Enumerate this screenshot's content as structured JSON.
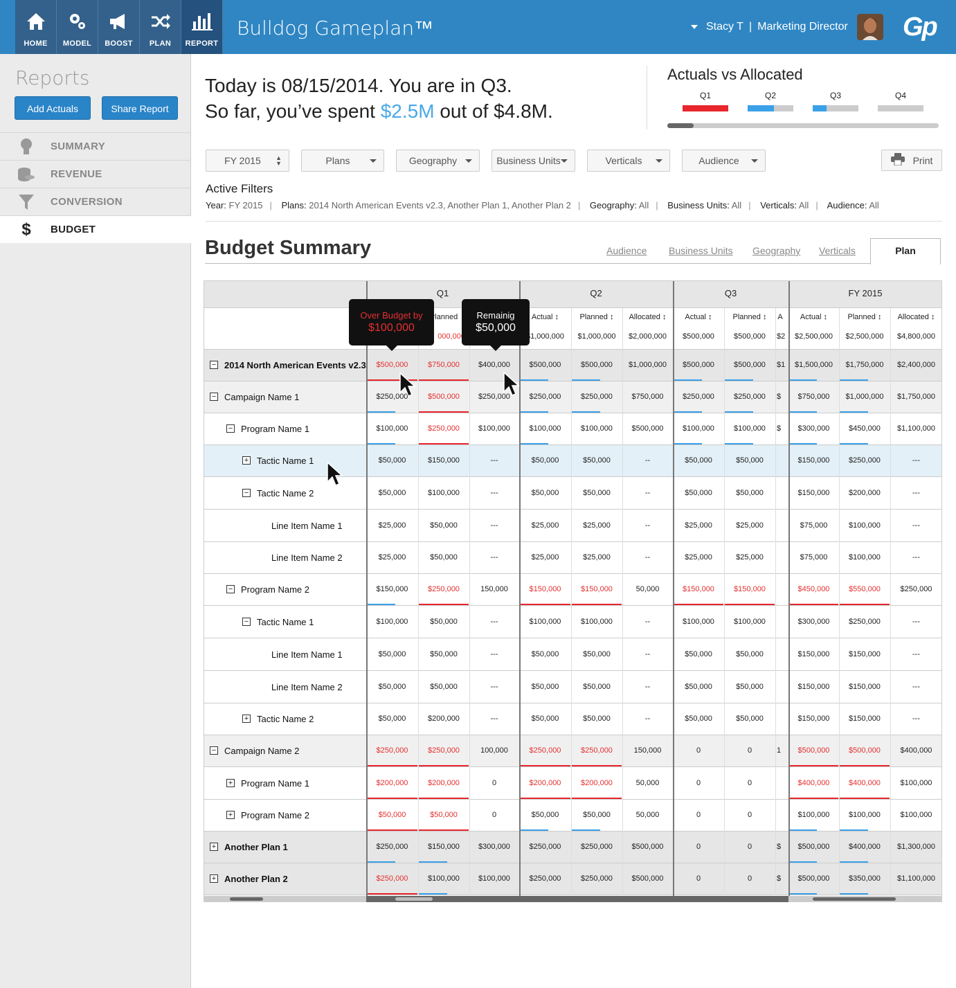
{
  "topbar": {
    "nav": [
      {
        "label": "HOME",
        "icon": "home-icon"
      },
      {
        "label": "MODEL",
        "icon": "gears-icon"
      },
      {
        "label": "BOOST",
        "icon": "megaphone-icon"
      },
      {
        "label": "PLAN",
        "icon": "shuffle-icon"
      },
      {
        "label": "REPORT",
        "icon": "bar-chart-icon"
      }
    ],
    "app_name": "Bulldog Gameplan™",
    "user_name": "Stacy T",
    "user_separator": "|",
    "user_role": "Marketing Director",
    "logo": "Gp"
  },
  "sidebar": {
    "title": "Reports",
    "add_actuals": "Add Actuals",
    "share_report": "Share Report",
    "items": [
      {
        "label": "SUMMARY",
        "icon": "lightbulb-icon"
      },
      {
        "label": "REVENUE",
        "icon": "coins-icon"
      },
      {
        "label": "CONVERSION",
        "icon": "funnel-icon"
      },
      {
        "label": "BUDGET",
        "icon": "dollar-icon"
      }
    ]
  },
  "summary": {
    "line1": "Today is 08/15/2014. You are in Q3.",
    "line2_pre": "So far, you’ve spent ",
    "spent": "$2.5M",
    "line2_post": " out of $4.8M."
  },
  "actuals_vs_allocated": {
    "title": "Actuals vs Allocated",
    "quarters": [
      {
        "label": "Q1",
        "fill": 1.0,
        "color": "#e8262c"
      },
      {
        "label": "Q2",
        "fill": 0.58,
        "color": "#3aa0e8"
      },
      {
        "label": "Q3",
        "fill": 0.3,
        "color": "#3aa0e8"
      },
      {
        "label": "Q4",
        "fill": 0.0,
        "color": "#3aa0e8"
      }
    ]
  },
  "filters": {
    "dropdowns": [
      "FY 2015",
      "Plans",
      "Geography",
      "Business Units",
      "Verticals",
      "Audience"
    ],
    "print": "Print",
    "active_title": "Active Filters",
    "active": [
      {
        "key": "Year:",
        "value": "FY 2015"
      },
      {
        "key": "Plans:",
        "value": "2014 North American Events v2.3, Another Plan 1, Another Plan 2"
      },
      {
        "key": "Geography:",
        "value": "All"
      },
      {
        "key": "Business Units:",
        "value": "All"
      },
      {
        "key": "Verticals:",
        "value": "All"
      },
      {
        "key": "Audience:",
        "value": "All"
      }
    ]
  },
  "budget": {
    "title": "Budget Summary",
    "tabs": [
      "Audience",
      "Business Units",
      "Geography",
      "Verticals"
    ],
    "active_tab": "Plan",
    "groups": [
      "Q1",
      "Q2",
      "Q3",
      "FY 2015"
    ],
    "subheaders": [
      "Actual",
      "Planned",
      "Allocated"
    ],
    "totals": [
      "",
      "",
      "",
      "$1,000,000",
      "$1,000,000",
      "$2,000,000",
      "$500,000",
      "$500,000",
      "$2",
      "$2,500,000",
      "$2,500,000",
      "$4,800,000"
    ],
    "tooltips": {
      "over_label": "Over Budget by",
      "over_value": "$100,000",
      "remain_label": "Remainig",
      "remain_value": "$50,000"
    },
    "rows": [
      {
        "name": "2014 North American Events v2.3",
        "level": 0,
        "toggle": "-",
        "bold": true,
        "shade": "#e6e6e6",
        "vals": [
          "$500,000",
          "$750,000",
          "$400,000",
          "$500,000",
          "$500,000",
          "$1,000,000",
          "$500,000",
          "$500,000",
          "$1",
          "$1,500,000",
          "$1,750,000",
          "$2,400,000"
        ],
        "red": [
          0,
          1
        ],
        "bars": {
          "0": "r",
          "1": "r",
          "3": "b",
          "4": "b",
          "6": "b",
          "7": "b",
          "9": "b",
          "10": "b"
        }
      },
      {
        "name": "Campaign Name 1",
        "level": 0,
        "toggle": "-",
        "bold": false,
        "shade": "#f0f0f0",
        "vals": [
          "$250,000",
          "$500,000",
          "$250,000",
          "$250,000",
          "$250,000",
          "$750,000",
          "$250,000",
          "$250,000",
          "$",
          "$750,000",
          "$1,000,000",
          "$1,750,000"
        ],
        "red": [
          1
        ],
        "bars": {
          "0": "b",
          "1": "r",
          "3": "b",
          "4": "b",
          "6": "b",
          "7": "b",
          "9": "b",
          "10": "b"
        }
      },
      {
        "name": "Program Name 1",
        "level": 1,
        "toggle": "-",
        "bold": false,
        "shade": "#fff",
        "vals": [
          "$100,000",
          "$250,000",
          "$100,000",
          "$100,000",
          "$100,000",
          "$500,000",
          "$100,000",
          "$100,000",
          "$",
          "$300,000",
          "$450,000",
          "$1,100,000"
        ],
        "red": [
          1
        ],
        "bars": {
          "0": "b",
          "1": "r",
          "3": "b",
          "6": "b",
          "7": "b",
          "9": "b",
          "10": "b"
        }
      },
      {
        "name": "Tactic Name 1",
        "level": 2,
        "toggle": "+",
        "bold": false,
        "shade": "#e3f0f8",
        "vals": [
          "$50,000",
          "$150,000",
          "---",
          "$50,000",
          "$50,000",
          "--",
          "$50,000",
          "$50,000",
          "",
          "$150,000",
          "$250,000",
          "---"
        ],
        "red": [],
        "bars": {}
      },
      {
        "name": "Tactic Name 2",
        "level": 2,
        "toggle": "-",
        "bold": false,
        "shade": "#fff",
        "vals": [
          "$50,000",
          "$100,000",
          "---",
          "$50,000",
          "$50,000",
          "--",
          "$50,000",
          "$50,000",
          "",
          "$150,000",
          "$200,000",
          "---"
        ],
        "red": [],
        "bars": {}
      },
      {
        "name": "Line Item Name 1",
        "level": 3,
        "toggle": "",
        "bold": false,
        "shade": "#fff",
        "vals": [
          "$25,000",
          "$50,000",
          "---",
          "$25,000",
          "$25,000",
          "--",
          "$25,000",
          "$25,000",
          "",
          "$75,000",
          "$100,000",
          "---"
        ],
        "red": [],
        "bars": {}
      },
      {
        "name": "Line Item Name 2",
        "level": 3,
        "toggle": "",
        "bold": false,
        "shade": "#fff",
        "vals": [
          "$25,000",
          "$50,000",
          "---",
          "$25,000",
          "$25,000",
          "--",
          "$25,000",
          "$25,000",
          "",
          "$75,000",
          "$100,000",
          "---"
        ],
        "red": [],
        "bars": {}
      },
      {
        "name": "Program Name 2",
        "level": 1,
        "toggle": "-",
        "bold": false,
        "shade": "#fff",
        "vals": [
          "$150,000",
          "$250,000",
          "150,000",
          "$150,000",
          "$150,000",
          "50,000",
          "$150,000",
          "$150,000",
          "",
          "$450,000",
          "$550,000",
          "$250,000"
        ],
        "red": [
          1,
          3,
          4,
          6,
          7,
          9,
          10
        ],
        "bars": {
          "0": "b",
          "1": "r",
          "3": "r",
          "4": "r",
          "6": "r",
          "7": "r",
          "9": "r",
          "10": "r"
        }
      },
      {
        "name": "Tactic Name 1",
        "level": 2,
        "toggle": "-",
        "bold": false,
        "shade": "#fff",
        "vals": [
          "$100,000",
          "$50,000",
          "---",
          "$100,000",
          "$100,000",
          "--",
          "$100,000",
          "$100,000",
          "",
          "$300,000",
          "$250,000",
          "---"
        ],
        "red": [],
        "bars": {}
      },
      {
        "name": "Line Item Name 1",
        "level": 3,
        "toggle": "",
        "bold": false,
        "shade": "#fff",
        "vals": [
          "$50,000",
          "$50,000",
          "---",
          "$50,000",
          "$50,000",
          "--",
          "$50,000",
          "$50,000",
          "",
          "$150,000",
          "$150,000",
          "---"
        ],
        "red": [],
        "bars": {}
      },
      {
        "name": "Line Item Name 2",
        "level": 3,
        "toggle": "",
        "bold": false,
        "shade": "#fff",
        "vals": [
          "$50,000",
          "$50,000",
          "---",
          "$50,000",
          "$50,000",
          "--",
          "$50,000",
          "$50,000",
          "",
          "$150,000",
          "$150,000",
          "---"
        ],
        "red": [],
        "bars": {}
      },
      {
        "name": "Tactic Name 2",
        "level": 2,
        "toggle": "+",
        "bold": false,
        "shade": "#fff",
        "vals": [
          "$50,000",
          "$200,000",
          "---",
          "$50,000",
          "$50,000",
          "--",
          "$50,000",
          "$50,000",
          "",
          "$150,000",
          "$150,000",
          "---"
        ],
        "red": [],
        "bars": {}
      },
      {
        "name": "Campaign Name 2",
        "level": 0,
        "toggle": "-",
        "bold": false,
        "shade": "#f0f0f0",
        "vals": [
          "$250,000",
          "$250,000",
          "100,000",
          "$250,000",
          "$250,000",
          "150,000",
          "0",
          "0",
          "1",
          "$500,000",
          "$500,000",
          "$400,000"
        ],
        "red": [
          0,
          1,
          3,
          4,
          9,
          10
        ],
        "bars": {
          "0": "r",
          "1": "r",
          "3": "r",
          "4": "r",
          "9": "r",
          "10": "r"
        }
      },
      {
        "name": "Program Name 1",
        "level": 1,
        "toggle": "+",
        "bold": false,
        "shade": "#fff",
        "vals": [
          "$200,000",
          "$200,000",
          "0",
          "$200,000",
          "$200,000",
          "50,000",
          "0",
          "0",
          "",
          "$400,000",
          "$400,000",
          "$100,000"
        ],
        "red": [
          0,
          1,
          3,
          4,
          9,
          10
        ],
        "bars": {
          "0": "r",
          "1": "r",
          "3": "r",
          "4": "r",
          "9": "r",
          "10": "r"
        }
      },
      {
        "name": "Program Name 2",
        "level": 1,
        "toggle": "+",
        "bold": false,
        "shade": "#fff",
        "vals": [
          "$50,000",
          "$50,000",
          "0",
          "$50,000",
          "$50,000",
          "50,000",
          "0",
          "0",
          "",
          "$100,000",
          "$100,000",
          "$100,000"
        ],
        "red": [
          0,
          1
        ],
        "bars": {
          "0": "r",
          "1": "r",
          "3": "b",
          "4": "b",
          "9": "b",
          "10": "b"
        }
      },
      {
        "name": "Another Plan 1",
        "level": 0,
        "toggle": "+",
        "bold": true,
        "shade": "#e6e6e6",
        "vals": [
          "$250,000",
          "$150,000",
          "$300,000",
          "$250,000",
          "$250,000",
          "$500,000",
          "0",
          "0",
          "$",
          "$500,000",
          "$400,000",
          "$1,300,000"
        ],
        "red": [],
        "bars": {
          "0": "b",
          "1": "b",
          "9": "b",
          "10": "b"
        }
      },
      {
        "name": "Another Plan 2",
        "level": 0,
        "toggle": "+",
        "bold": true,
        "shade": "#e6e6e6",
        "vals": [
          "$250,000",
          "$100,000",
          "$100,000",
          "$250,000",
          "$250,000",
          "$500,000",
          "0",
          "0",
          "$",
          "$500,000",
          "$350,000",
          "$1,100,000"
        ],
        "red": [
          0
        ],
        "bars": {
          "0": "r",
          "1": "b",
          "9": "b",
          "10": "b"
        }
      }
    ]
  }
}
